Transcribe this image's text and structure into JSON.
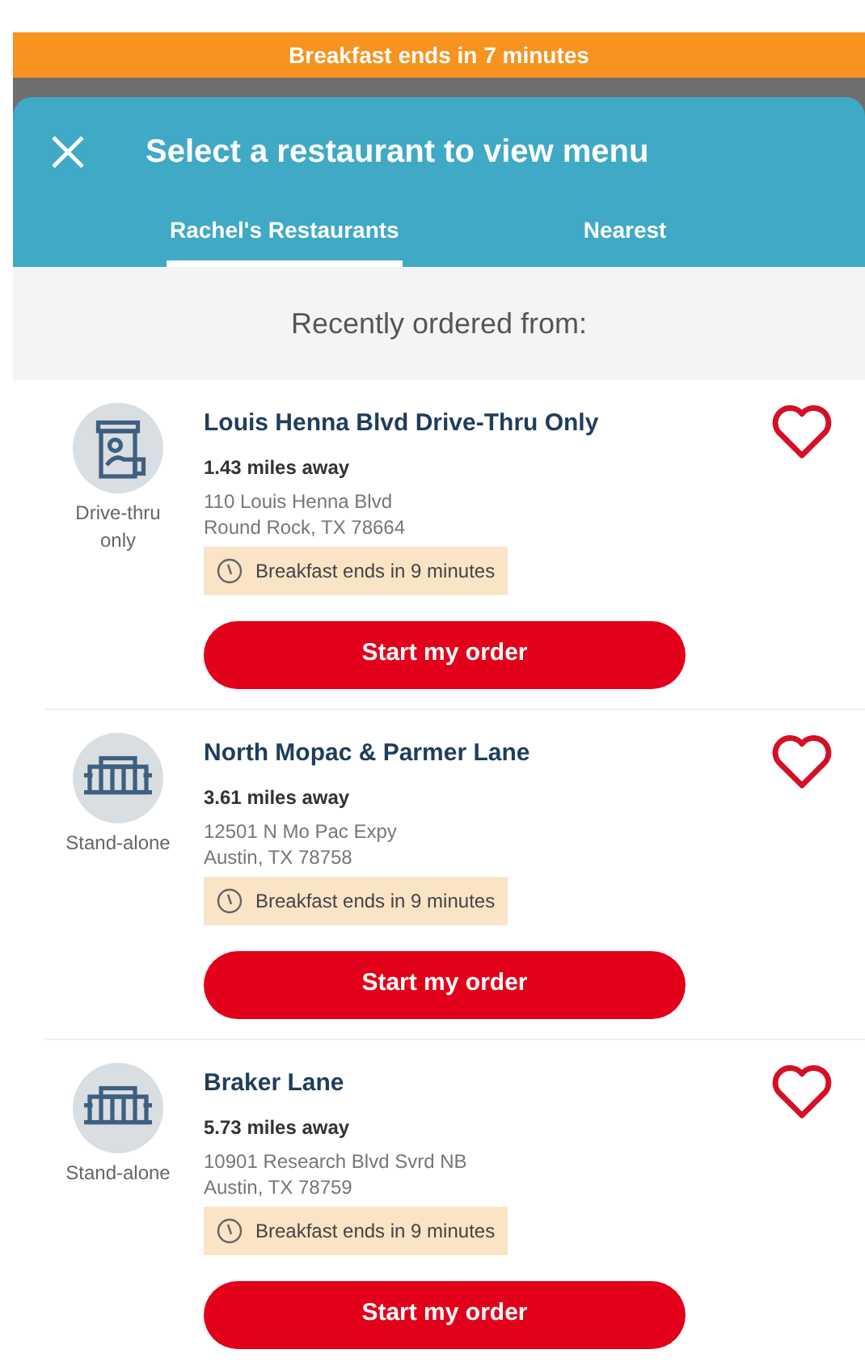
{
  "banner": "Breakfast ends in 7 minutes",
  "header": {
    "title": "Select a restaurant to view menu"
  },
  "tabs": [
    {
      "label": "Rachel's Restaurants",
      "selected": true
    },
    {
      "label": "Nearest",
      "selected": false
    }
  ],
  "section_title": "Recently ordered from:",
  "restaurants": [
    {
      "kind": "drive-thru",
      "type_label": "Drive-thru only",
      "name": "Louis Henna Blvd Drive-Thru Only",
      "distance": "1.43 miles away",
      "address_line_1": "110 Louis Henna Blvd",
      "address_line_2": "Round Rock, TX 78664",
      "notice": "Breakfast ends in 9 minutes",
      "button": "Start my order",
      "favorite": false
    },
    {
      "kind": "stand-alone",
      "type_label": "Stand-alone",
      "name": "North Mopac & Parmer Lane",
      "distance": "3.61 miles away",
      "address_line_1": "12501 N Mo Pac Expy",
      "address_line_2": "Austin, TX 78758",
      "notice": "Breakfast ends in 9 minutes",
      "button": "Start my order",
      "favorite": false
    },
    {
      "kind": "stand-alone",
      "type_label": "Stand-alone",
      "name": "Braker Lane",
      "distance": "5.73 miles away",
      "address_line_1": "10901 Research Blvd Svrd NB",
      "address_line_2": "Austin, TX 78759",
      "notice": "Breakfast ends in 9 minutes",
      "button": "Start my order",
      "favorite": false
    }
  ]
}
